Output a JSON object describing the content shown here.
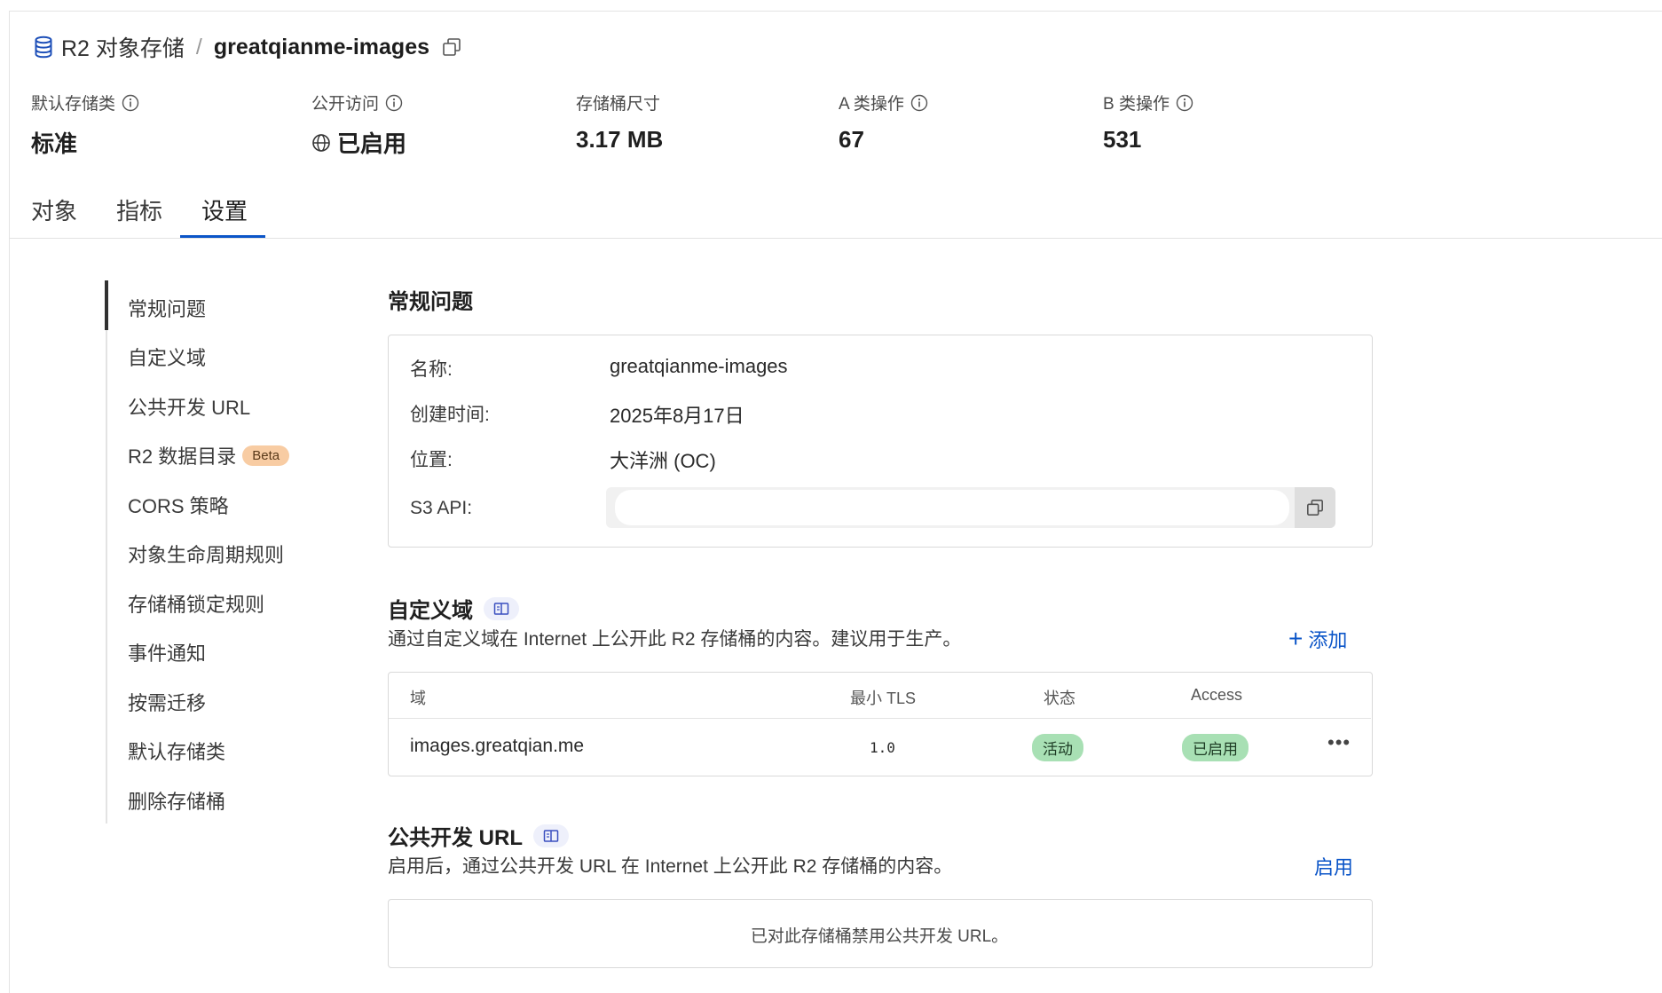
{
  "breadcrumb": {
    "root": "R2 对象存储",
    "separator": "/",
    "current": "greatqianme-images"
  },
  "stats": [
    {
      "label": "默认存储类",
      "value": "标准",
      "has_info": true
    },
    {
      "label": "公开访问",
      "value": "已启用",
      "has_info": true,
      "value_icon": "globe-icon"
    },
    {
      "label": "存储桶尺寸",
      "value": "3.17 MB",
      "has_info": false
    },
    {
      "label": "A 类操作",
      "value": "67",
      "has_info": true
    },
    {
      "label": "B 类操作",
      "value": "531",
      "has_info": true
    }
  ],
  "tabs": [
    {
      "label": "对象",
      "active": false
    },
    {
      "label": "指标",
      "active": false
    },
    {
      "label": "设置",
      "active": true
    }
  ],
  "side_nav": {
    "items": [
      {
        "label": "常规问题",
        "active": true
      },
      {
        "label": "自定义域"
      },
      {
        "label": "公共开发 URL"
      },
      {
        "label": "R2 数据目录",
        "badge": "Beta"
      },
      {
        "label": "CORS 策略"
      },
      {
        "label": "对象生命周期规则"
      },
      {
        "label": "存储桶锁定规则"
      },
      {
        "label": "事件通知"
      },
      {
        "label": "按需迁移"
      },
      {
        "label": "默认存储类"
      },
      {
        "label": "删除存储桶"
      }
    ]
  },
  "general": {
    "title": "常规问题",
    "rows": [
      {
        "label": "名称:",
        "value": "greatqianme-images"
      },
      {
        "label": "创建时间:",
        "value": "2025年8月17日"
      },
      {
        "label": "位置:",
        "value": "大洋洲 (OC)"
      },
      {
        "label": "S3 API:",
        "value": ""
      }
    ]
  },
  "custom_domain": {
    "title": "自定义域",
    "description": "通过自定义域在 Internet 上公开此 R2 存储桶的内容。建议用于生产。",
    "add_label": "添加",
    "table": {
      "headers": [
        "域",
        "最小 TLS",
        "状态",
        "Access"
      ],
      "rows": [
        {
          "domain": "images.greatqian.me",
          "min_tls": "1.0",
          "status": "活动",
          "access": "已启用"
        }
      ]
    }
  },
  "public_dev_url": {
    "title": "公共开发 URL",
    "description": "启用后，通过公共开发 URL 在 Internet 上公开此 R2 存储桶的内容。",
    "enable_label": "启用",
    "empty_message": "已对此存储桶禁用公共开发 URL。"
  },
  "colors": {
    "accent": "#0b55c8",
    "pill_green": "#a8e0b4",
    "beta_badge": "#f8cca3",
    "border": "#d9d9d9"
  }
}
